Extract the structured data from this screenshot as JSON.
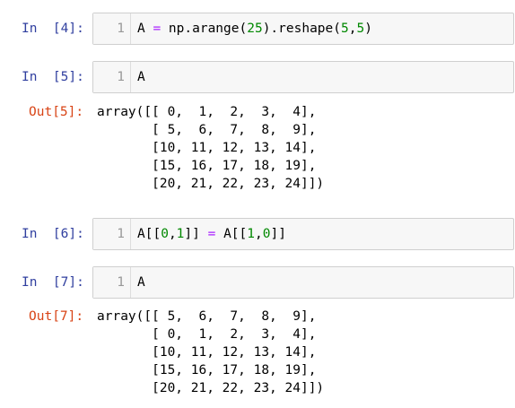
{
  "cells": [
    {
      "prompt": "In  [4]:",
      "line_number": "1",
      "code_tokens": {
        "t1": "A ",
        "t2": "=",
        "t3": " np.arange(",
        "t4": "25",
        "t5": ").reshape(",
        "t6": "5",
        "t7": ",",
        "t8": "5",
        "t9": ")"
      }
    },
    {
      "prompt": "In  [5]:",
      "line_number": "1",
      "code": "A",
      "out_prompt": "Out[5]:",
      "output": "array([[ 0,  1,  2,  3,  4],\n       [ 5,  6,  7,  8,  9],\n       [10, 11, 12, 13, 14],\n       [15, 16, 17, 18, 19],\n       [20, 21, 22, 23, 24]])"
    },
    {
      "prompt": "In  [6]:",
      "line_number": "1",
      "code_tokens": {
        "t1": "A[[",
        "t2": "0",
        "t3": ",",
        "t4": "1",
        "t5": "]] ",
        "t6": "=",
        "t7": " A[[",
        "t8": "1",
        "t9": ",",
        "t10": "0",
        "t11": "]]"
      }
    },
    {
      "prompt": "In  [7]:",
      "line_number": "1",
      "code": "A",
      "out_prompt": "Out[7]:",
      "output": "array([[ 5,  6,  7,  8,  9],\n       [ 0,  1,  2,  3,  4],\n       [10, 11, 12, 13, 14],\n       [15, 16, 17, 18, 19],\n       [20, 21, 22, 23, 24]])"
    }
  ]
}
